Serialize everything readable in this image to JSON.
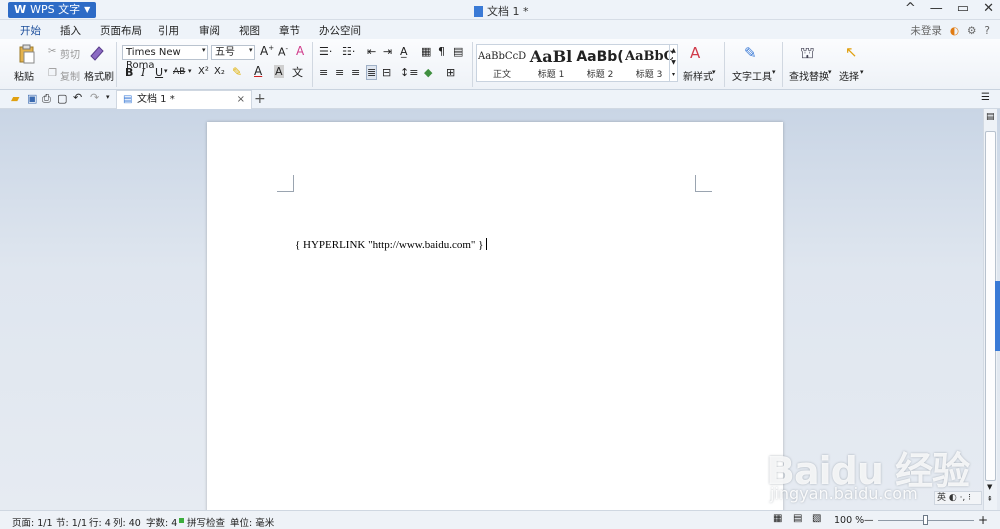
{
  "titlebar": {
    "app_name": "WPS 文字",
    "doc_title": "文档 1 *",
    "controls": [
      "^",
      "—",
      "▭",
      "✕"
    ]
  },
  "menu_tabs": [
    "开始",
    "插入",
    "页面布局",
    "引用",
    "审阅",
    "视图",
    "章节",
    "办公空间"
  ],
  "account": {
    "login": "未登录",
    "help": "?"
  },
  "ribbon": {
    "paste": "粘贴",
    "cut": "剪切",
    "copy": "复制",
    "format_painter": "格式刷",
    "font_name": "Times New Roma",
    "font_size": "五号",
    "bold": "B",
    "italic": "I",
    "underline": "U",
    "strike": "AB",
    "superscript": "X²",
    "subscript": "X₂",
    "styles": [
      {
        "sample": "AaBbCcDd",
        "label": "正文"
      },
      {
        "sample": "AaBl",
        "label": "标题 1"
      },
      {
        "sample": "AaBb(",
        "label": "标题 2"
      },
      {
        "sample": "AaBbC",
        "label": "标题 3"
      }
    ],
    "new_style": "新样式",
    "text_tools": "文字工具",
    "find_replace": "查找替换",
    "select": "选择"
  },
  "doc_tab": {
    "label": "文档 1 *",
    "close": "×",
    "new": "+"
  },
  "document": {
    "field_code": "{ HYPERLINK \"http://www.baidu.com\" }"
  },
  "watermark": {
    "line1": "Baidu 经验",
    "line2": "jingyan.baidu.com"
  },
  "ime": "英 ◐ ·, ⁝",
  "statusbar": {
    "page": "页面: 1/1",
    "section": "节: 1/1",
    "row": "行: 4",
    "col": "列: 40",
    "words": "字数: 4",
    "spell": "拼写检查",
    "unit": "单位: 毫米",
    "zoom": "100 %",
    "zoom_minus": "—",
    "zoom_plus": "+"
  },
  "colors": {
    "accent": "#2d6bc6",
    "spell_dot": "#3cae3c"
  }
}
